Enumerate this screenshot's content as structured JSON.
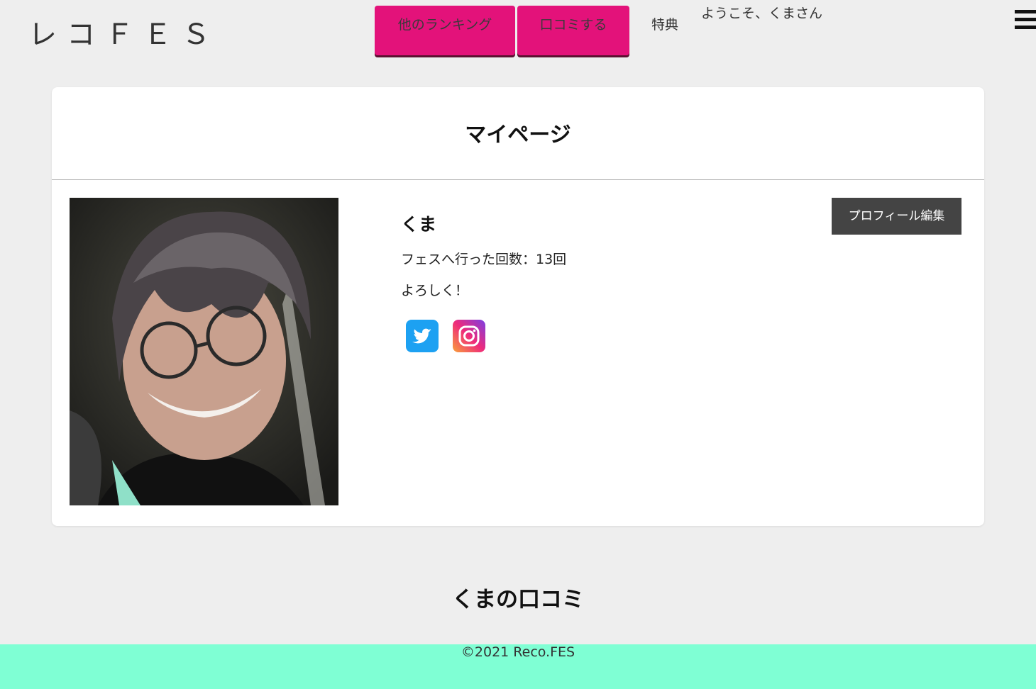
{
  "header": {
    "logo": "レコＦＥＳ",
    "nav": {
      "ranking_label": "他のランキング",
      "review_label": "口コミする",
      "perk_label": "特典",
      "welcome": "ようこそ、くまさん"
    },
    "menu_icon": "hamburger-menu-icon"
  },
  "profile_card": {
    "title": "マイページ",
    "photo_alt": "profile-photo",
    "username": "くま",
    "visits": "フェスへ行った回数：13回",
    "bio": "よろしく！",
    "edit_button": "プロフィール編集",
    "social": {
      "twitter_icon": "twitter-icon",
      "instagram_icon": "instagram-icon",
      "twitter_color": "#1da1f2"
    }
  },
  "reviews": {
    "title": "くまの口コミ"
  },
  "footer": {
    "copyright": "©2021 Reco.FES",
    "background_color": "#7fffd4"
  },
  "colors": {
    "accent": "#e3127a",
    "page_bg": "#eeeeee",
    "edit_button_bg": "#444444"
  }
}
